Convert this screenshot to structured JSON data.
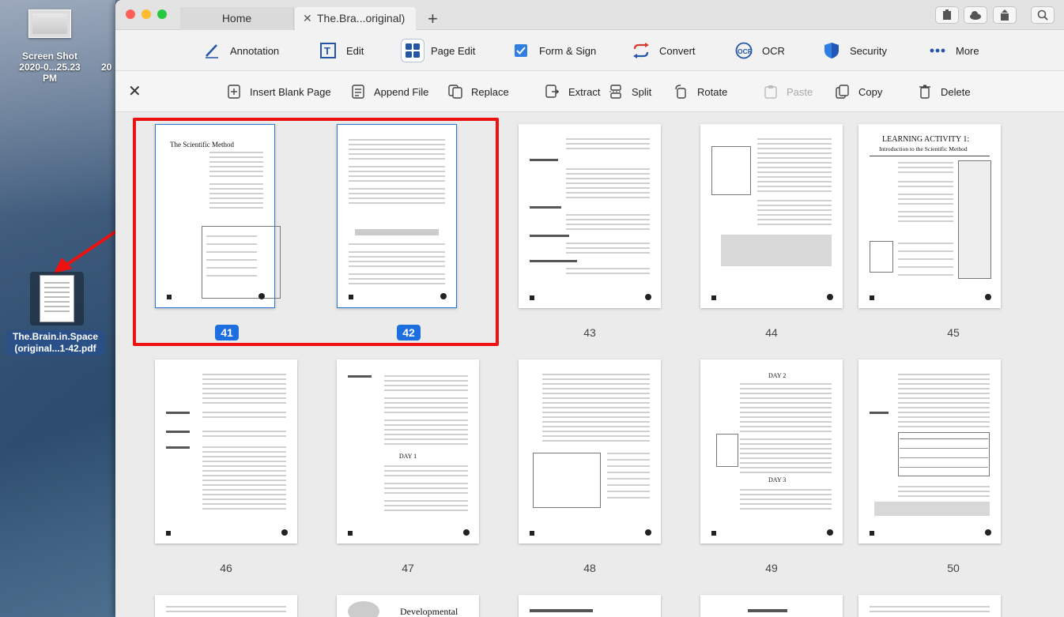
{
  "desktop": {
    "screenshot_label_1": "Screen Shot",
    "screenshot_label_2": "2020-0...25.23 PM",
    "screenshot_cut": "20",
    "pdf_label": "The.Brain.in.Space (original...1-42.pdf"
  },
  "window": {
    "tabs": [
      {
        "label": "Home"
      },
      {
        "label": "The.Bra...original)",
        "close": "✕"
      }
    ],
    "new_tab": "+"
  },
  "toolbar": {
    "items": [
      {
        "label": "Annotation",
        "icon": "pen-icon"
      },
      {
        "label": "Edit",
        "icon": "text-edit-icon"
      },
      {
        "label": "Page Edit",
        "icon": "grid-icon"
      },
      {
        "label": "Form & Sign",
        "icon": "checkbox-icon"
      },
      {
        "label": "Convert",
        "icon": "convert-icon"
      },
      {
        "label": "OCR",
        "icon": "ocr-icon"
      },
      {
        "label": "Security",
        "icon": "shield-icon"
      },
      {
        "label": "More",
        "icon": "more-icon"
      }
    ]
  },
  "subbar": {
    "close": "✕",
    "items": [
      {
        "label": "Insert Blank Page"
      },
      {
        "label": "Append File"
      },
      {
        "label": "Replace"
      },
      {
        "label": "Extract"
      },
      {
        "label": "Split"
      },
      {
        "label": "Rotate"
      },
      {
        "label": "Paste"
      },
      {
        "label": "Copy"
      },
      {
        "label": "Delete"
      }
    ]
  },
  "pages": {
    "row1": [
      "41",
      "42",
      "43",
      "44",
      "45"
    ],
    "row2": [
      "46",
      "47",
      "48",
      "49",
      "50"
    ],
    "titles": {
      "p41": "The Scientific Method",
      "p45_title": "LEARNING ACTIVITY 1:",
      "p45_sub": "Introduction to the Scientific Method",
      "p48_heading": "DAY 1",
      "p49_heading": "DAY 2",
      "p49_heading2": "DAY 3",
      "p52_title": "Developmental"
    },
    "selected": [
      "41",
      "42"
    ]
  },
  "colors": {
    "accent": "#1d6fe0",
    "selection": "#ee1111"
  }
}
